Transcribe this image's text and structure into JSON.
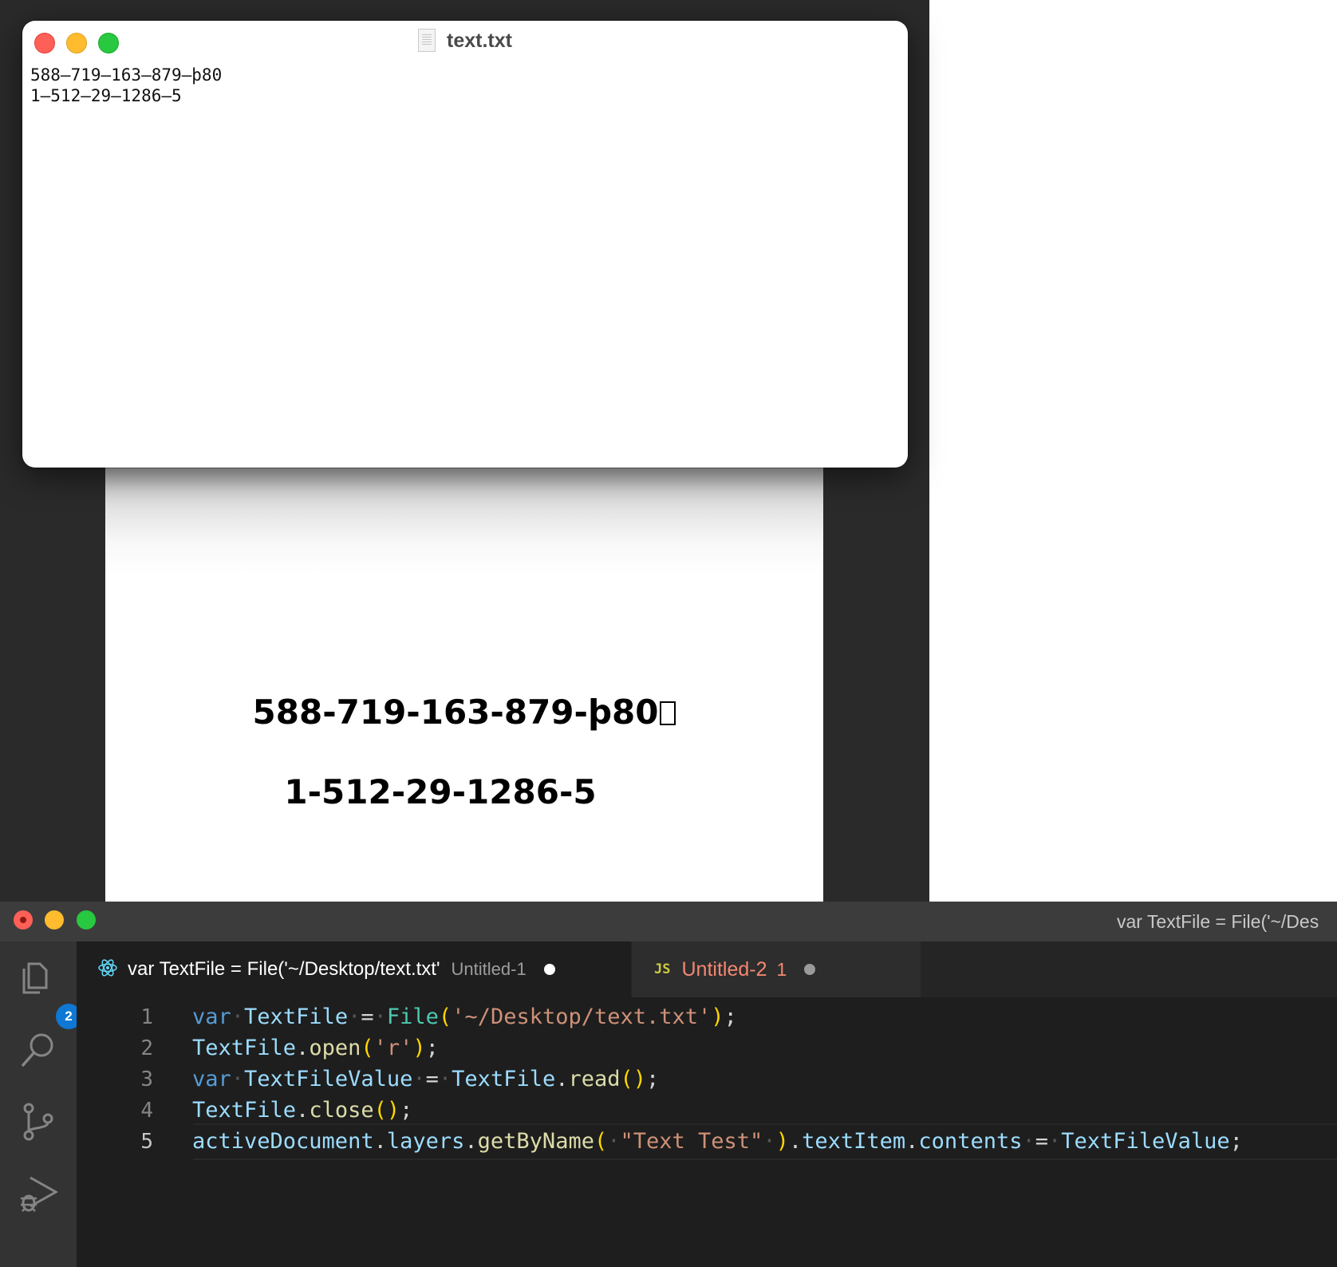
{
  "textedit": {
    "title": "text.txt",
    "lines": [
      "588–719–163–879–þ80",
      "1–512–29–1286–5"
    ]
  },
  "document_preview": {
    "line1": "588-719-163-879-þ80",
    "line2": "1-512-29-1286-5"
  },
  "vscode": {
    "window_title": "var TextFile = File('~/Des",
    "activity_bar": {
      "items": [
        "explorer-icon",
        "search-icon",
        "source-control-icon",
        "run-debug-icon"
      ],
      "explorer_badge": "2"
    },
    "tabs": [
      {
        "icon": "react-icon",
        "label": "var TextFile = File('~/Desktop/text.txt'",
        "description": "Untitled-1",
        "dirty": true
      },
      {
        "icon": "js-icon",
        "icon_text": "JS",
        "label": "Untitled-2",
        "problems": "1",
        "dirty": true
      }
    ],
    "editor": {
      "line_numbers": [
        "1",
        "2",
        "3",
        "4",
        "5"
      ],
      "current_line": 5,
      "tokens": {
        "l1": [
          "var",
          "TextFile",
          "=",
          "File",
          "(",
          "'~/Desktop/text.txt'",
          ")",
          ";"
        ],
        "l2": [
          "TextFile",
          ".",
          "open",
          "(",
          "'r'",
          ")",
          ";"
        ],
        "l3": [
          "var",
          "TextFileValue",
          "=",
          "TextFile",
          ".",
          "read",
          "(",
          ")",
          ";"
        ],
        "l4": [
          "TextFile",
          ".",
          "close",
          "(",
          ")",
          ";"
        ],
        "l5": [
          "activeDocument",
          ".",
          "layers",
          ".",
          "getByName",
          "(",
          "\"Text Test\"",
          ")",
          ".",
          "textItem",
          ".",
          "contents",
          "=",
          "TextFileValue",
          ";"
        ]
      }
    },
    "colors": {
      "keyword": "#569cd6",
      "variable": "#9cdcfe",
      "class": "#4ec9b0",
      "function": "#dcdcaa",
      "string": "#ce9178",
      "bracket": "#ffd700",
      "error_tab": "#f48771",
      "badge": "#0e78d4"
    }
  }
}
